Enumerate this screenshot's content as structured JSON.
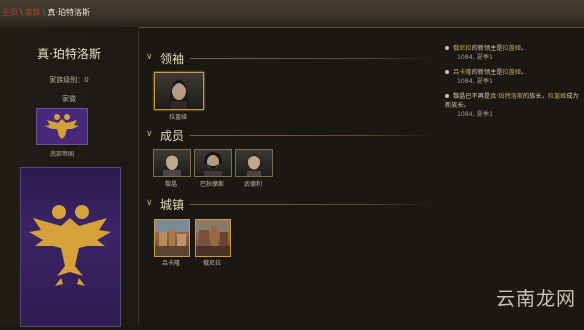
{
  "breadcrumb": {
    "items": [
      "主页",
      "家族"
    ],
    "current": "真·珀特洛斯",
    "separator": "\\"
  },
  "clan": {
    "name": "真·珀特洛斯",
    "tier": "家族级别：0",
    "faction_label": "家徽",
    "kingdom": "南部帝国"
  },
  "sections": {
    "leader": {
      "title": "领袖",
      "members": [
        {
          "name": "拉盖娅"
        }
      ]
    },
    "members": {
      "title": "成员",
      "members": [
        {
          "name": "黎晶"
        },
        {
          "name": "巴狄摩斯"
        },
        {
          "name": "武德利"
        }
      ]
    },
    "towns": {
      "title": "城镇",
      "items": [
        {
          "name": "吕卡隆"
        },
        {
          "name": "俄尼拉"
        }
      ]
    }
  },
  "log": [
    {
      "parts": [
        {
          "text": "俄尼拉",
          "hl": true
        },
        {
          "text": "的新领主是",
          "hl": false
        },
        {
          "text": "拉盖娅",
          "hl": true
        },
        {
          "text": "。",
          "hl": false
        }
      ],
      "date": "1084, 夏季1"
    },
    {
      "parts": [
        {
          "text": "吕卡隆",
          "hl": true
        },
        {
          "text": "的新领主是",
          "hl": false
        },
        {
          "text": "拉盖娅",
          "hl": true
        },
        {
          "text": "。",
          "hl": false
        }
      ],
      "date": "1084, 夏季1"
    },
    {
      "parts": [
        {
          "text": "黎晶已不再是",
          "hl": false
        },
        {
          "text": "真·珀特洛斯",
          "hl": true
        },
        {
          "text": "的族长，",
          "hl": false
        },
        {
          "text": "拉盖娅",
          "hl": true
        },
        {
          "text": "成为新族长。",
          "hl": false
        }
      ],
      "date": "1084, 夏季1"
    }
  ],
  "watermark": "云南龙网",
  "colors": {
    "accent_gold": "#c9a961",
    "link_red": "#a8432a",
    "banner_purple": "#47287a"
  }
}
